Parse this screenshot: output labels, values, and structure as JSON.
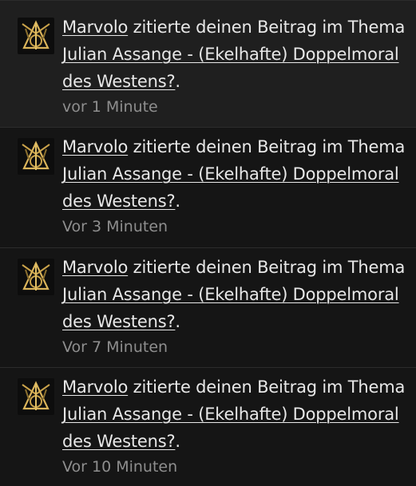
{
  "notifications": [
    {
      "user": "Marvolo",
      "action": " zitierte deinen Beitrag im Thema ",
      "thread": "Julian Assange - (Ekelhafte) Doppelmoral des Westens?",
      "suffix": ".",
      "time": "vor 1 Minute",
      "avatar_icon": "deathly-hallows-icon"
    },
    {
      "user": "Marvolo",
      "action": " zitierte deinen Beitrag im Thema ",
      "thread": "Julian Assange - (Ekelhafte) Doppelmoral des Westens?",
      "suffix": ".",
      "time": "Vor 3 Minuten",
      "avatar_icon": "deathly-hallows-icon"
    },
    {
      "user": "Marvolo",
      "action": " zitierte deinen Beitrag im Thema ",
      "thread": "Julian Assange - (Ekelhafte) Doppelmoral des Westens?",
      "suffix": ".",
      "time": "Vor 7 Minuten",
      "avatar_icon": "deathly-hallows-icon"
    },
    {
      "user": "Marvolo",
      "action": " zitierte deinen Beitrag im Thema ",
      "thread": "Julian Assange - (Ekelhafte) Doppelmoral des Westens?",
      "suffix": ".",
      "time": "Vor 10 Minuten",
      "avatar_icon": "deathly-hallows-icon"
    }
  ],
  "colors": {
    "background": "#151515",
    "unread_background": "#1f1f1f",
    "text": "#e8e8e8",
    "time_text": "#8e8e8e",
    "avatar_gold": "#c9a24a"
  }
}
